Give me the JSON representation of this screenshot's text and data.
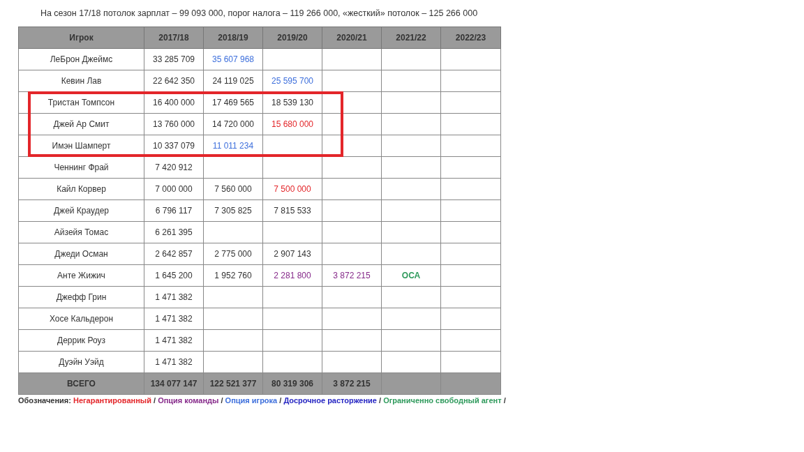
{
  "caption": "На сезон 17/18 потолок зарплат – 99 093 000, порог налога – 119 266 000, «жесткий» потолок – 125 266 000",
  "table": {
    "columns": [
      "Игрок",
      "2017/18",
      "2018/19",
      "2019/20",
      "2020/21",
      "2021/22",
      "2022/23"
    ],
    "rows": [
      {
        "highlighted": false,
        "cells": [
          {
            "text": "ЛеБрон Джеймс",
            "kind": "player"
          },
          {
            "text": "33 285 709",
            "kind": "plain"
          },
          {
            "text": "35 607 968",
            "kind": "player_option"
          },
          "",
          "",
          "",
          ""
        ]
      },
      {
        "highlighted": false,
        "cells": [
          {
            "text": "Кевин Лав",
            "kind": "player"
          },
          {
            "text": "22 642 350",
            "kind": "plain"
          },
          {
            "text": "24 119 025",
            "kind": "plain"
          },
          {
            "text": "25 595 700",
            "kind": "player_option"
          },
          "",
          "",
          ""
        ]
      },
      {
        "highlighted": true,
        "cells": [
          {
            "text": "Тристан Томпсон",
            "kind": "player"
          },
          {
            "text": "16 400 000",
            "kind": "plain"
          },
          {
            "text": "17 469 565",
            "kind": "plain"
          },
          {
            "text": "18 539 130",
            "kind": "plain"
          },
          "",
          "",
          ""
        ]
      },
      {
        "highlighted": true,
        "cells": [
          {
            "text": "Джей Ар Смит",
            "kind": "player"
          },
          {
            "text": "13 760 000",
            "kind": "plain"
          },
          {
            "text": "14 720 000",
            "kind": "plain"
          },
          {
            "text": "15 680 000",
            "kind": "nonguaranteed"
          },
          "",
          "",
          ""
        ]
      },
      {
        "highlighted": true,
        "cells": [
          {
            "text": "Имэн Шамперт",
            "kind": "player"
          },
          {
            "text": "10 337 079",
            "kind": "plain"
          },
          {
            "text": "11 011 234",
            "kind": "player_option"
          },
          "",
          "",
          "",
          ""
        ]
      },
      {
        "highlighted": false,
        "cells": [
          {
            "text": "Ченнинг Фрай",
            "kind": "player"
          },
          {
            "text": "7 420 912",
            "kind": "plain"
          },
          "",
          "",
          "",
          "",
          ""
        ]
      },
      {
        "highlighted": false,
        "cells": [
          {
            "text": "Кайл Корвер",
            "kind": "player"
          },
          {
            "text": "7 000 000",
            "kind": "plain"
          },
          {
            "text": "7 560 000",
            "kind": "plain"
          },
          {
            "text": "7 500 000",
            "kind": "nonguaranteed"
          },
          "",
          "",
          ""
        ]
      },
      {
        "highlighted": false,
        "cells": [
          {
            "text": "Джей Краудер",
            "kind": "player"
          },
          {
            "text": "6 796 117",
            "kind": "plain"
          },
          {
            "text": "7 305 825",
            "kind": "plain"
          },
          {
            "text": "7 815 533",
            "kind": "plain"
          },
          "",
          "",
          ""
        ]
      },
      {
        "highlighted": false,
        "cells": [
          {
            "text": "Айзейя Томас",
            "kind": "player"
          },
          {
            "text": "6 261 395",
            "kind": "plain"
          },
          "",
          "",
          "",
          "",
          ""
        ]
      },
      {
        "highlighted": false,
        "cells": [
          {
            "text": "Джеди Осман",
            "kind": "player"
          },
          {
            "text": "2 642 857",
            "kind": "plain"
          },
          {
            "text": "2 775 000",
            "kind": "plain"
          },
          {
            "text": "2 907 143",
            "kind": "plain"
          },
          "",
          "",
          ""
        ]
      },
      {
        "highlighted": false,
        "cells": [
          {
            "text": "Анте Жижич",
            "kind": "player"
          },
          {
            "text": "1 645 200",
            "kind": "plain"
          },
          {
            "text": "1 952 760",
            "kind": "plain"
          },
          {
            "text": "2 281 800",
            "kind": "team_option"
          },
          {
            "text": "3 872 215",
            "kind": "team_option"
          },
          {
            "text": "ОСА",
            "kind": "restricted_free_agent"
          },
          ""
        ]
      },
      {
        "highlighted": false,
        "cells": [
          {
            "text": "Джефф Грин",
            "kind": "player"
          },
          {
            "text": "1 471 382",
            "kind": "plain"
          },
          "",
          "",
          "",
          "",
          ""
        ]
      },
      {
        "highlighted": false,
        "cells": [
          {
            "text": "Хосе Кальдерон",
            "kind": "player"
          },
          {
            "text": "1 471 382",
            "kind": "plain"
          },
          "",
          "",
          "",
          "",
          ""
        ]
      },
      {
        "highlighted": false,
        "cells": [
          {
            "text": "Деррик Роуз",
            "kind": "player"
          },
          {
            "text": "1 471 382",
            "kind": "plain"
          },
          "",
          "",
          "",
          "",
          ""
        ]
      },
      {
        "highlighted": false,
        "cells": [
          {
            "text": "Дуэйн Уэйд",
            "kind": "player"
          },
          {
            "text": "1 471 382",
            "kind": "plain"
          },
          "",
          "",
          "",
          "",
          ""
        ]
      }
    ],
    "total": [
      "ВСЕГО",
      "134 077 147",
      "122 521 377",
      "80 319 306",
      "3 872 215"
    ]
  },
  "legend": {
    "label": "Обозначения:",
    "separator": "/",
    "items": [
      {
        "text": "Негарантированный",
        "kind": "nonguaranteed"
      },
      {
        "text": "Опция команды",
        "kind": "team_option"
      },
      {
        "text": "Опция игрока",
        "kind": "player_option"
      },
      {
        "text": "Досрочное расторжение",
        "kind": "early_termination"
      },
      {
        "text": "Ограниченно свободный агент",
        "kind": "restricted_free_agent"
      }
    ]
  }
}
